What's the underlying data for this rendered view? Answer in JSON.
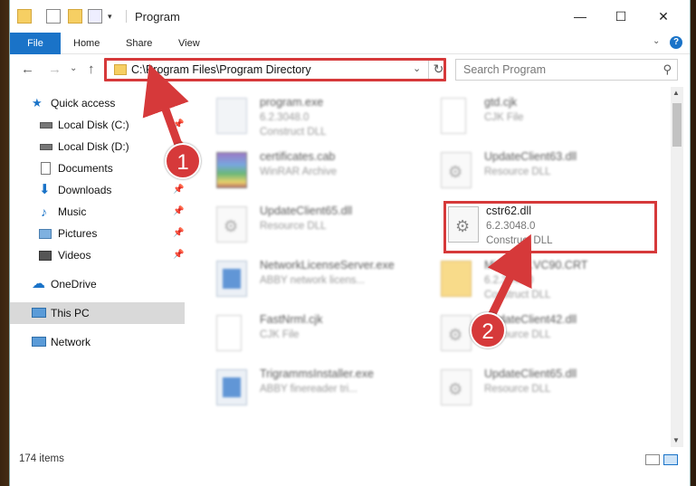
{
  "window": {
    "title": "Program",
    "ribbon_tabs": [
      "File",
      "Home",
      "Share",
      "View"
    ],
    "controls": {
      "minimize": "—",
      "maximize": "☐",
      "close": "✕"
    },
    "help": "?"
  },
  "nav": {
    "back": "←",
    "forward": "→",
    "recent": "⌄",
    "up": "↑",
    "address": "C:\\Program Files\\Program Directory",
    "dropdown": "⌄",
    "refresh": "↻",
    "search_placeholder": "Search Program",
    "search_icon": "⚲"
  },
  "sidebar": {
    "items": [
      {
        "label": "Quick access",
        "icon": "star-icon",
        "pinned": false
      },
      {
        "label": "Local Disk (C:)",
        "icon": "drive-icon",
        "pinned": true
      },
      {
        "label": "Local Disk (D:)",
        "icon": "drive-icon",
        "pinned": true
      },
      {
        "label": "Documents",
        "icon": "documents-icon",
        "pinned": true
      },
      {
        "label": "Downloads",
        "icon": "download-icon",
        "pinned": true
      },
      {
        "label": "Music",
        "icon": "music-icon",
        "pinned": true
      },
      {
        "label": "Pictures",
        "icon": "pictures-icon",
        "pinned": true
      },
      {
        "label": "Videos",
        "icon": "videos-icon",
        "pinned": true
      },
      {
        "label": "OneDrive",
        "icon": "cloud-icon",
        "pinned": false
      },
      {
        "label": "This PC",
        "icon": "computer-icon",
        "pinned": false,
        "selected": true
      },
      {
        "label": "Network",
        "icon": "network-icon",
        "pinned": false
      }
    ]
  },
  "files": [
    {
      "name": "program.exe",
      "meta1": "6.2.3048.0",
      "meta2": "Construct DLL",
      "icon": "program-icon"
    },
    {
      "name": "gtd.cjk",
      "meta1": "CJK File",
      "meta2": "",
      "icon": "document-icon"
    },
    {
      "name": "certificates.cab",
      "meta1": "WinRAR Archive",
      "meta2": "",
      "icon": "archive-icon"
    },
    {
      "name": "UpdateClient63.dll",
      "meta1": "Resource DLL",
      "meta2": "",
      "icon": "dll-icon"
    },
    {
      "name": "UpdateClient65.dll",
      "meta1": "Resource DLL",
      "meta2": "",
      "icon": "dll-icon"
    },
    {
      "name": "cstr62.dll",
      "meta1": "6.2.3048.0",
      "meta2": "Construct DLL",
      "icon": "dll-icon"
    },
    {
      "name": "NetworkLicenseServer.exe",
      "meta1": "ABBY network licens...",
      "meta2": "",
      "icon": "exe-icon"
    },
    {
      "name": "Microsoft.VC90.CRT",
      "meta1": "6.2.3048.0",
      "meta2": "Construct DLL",
      "icon": "folder-icon"
    },
    {
      "name": "FastNrml.cjk",
      "meta1": "CJK File",
      "meta2": "",
      "icon": "document-icon"
    },
    {
      "name": "UpdateClient42.dll",
      "meta1": "Resource DLL",
      "meta2": "",
      "icon": "dll-icon"
    },
    {
      "name": "TrigrammsInstaller.exe",
      "meta1": "ABBY finereader tri...",
      "meta2": "",
      "icon": "exe-icon"
    },
    {
      "name": "UpdateClient65.dll",
      "meta1": "Resource DLL",
      "meta2": "",
      "icon": "dll-icon"
    }
  ],
  "status": {
    "items_count": "174 items"
  },
  "callouts": [
    "1",
    "2"
  ],
  "colors": {
    "accent": "#1a73c8",
    "highlight": "#d6393a"
  }
}
